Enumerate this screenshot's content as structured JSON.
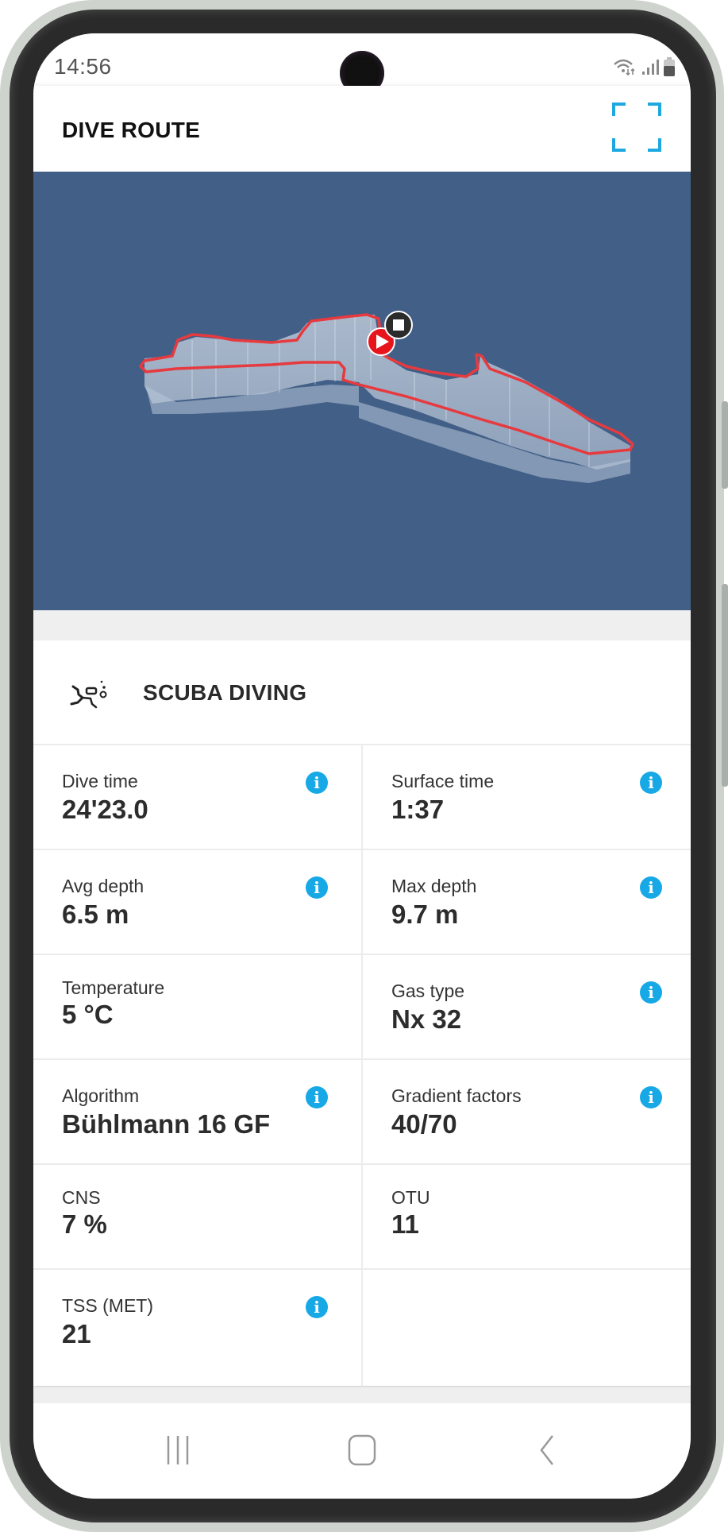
{
  "status_bar": {
    "time": "14:56",
    "icons": [
      "wifi-icon",
      "signal-icon",
      "battery-icon"
    ]
  },
  "app_bar": {
    "title": "DIVE ROUTE",
    "fullscreen_icon": "fullscreen-icon"
  },
  "map": {
    "background_color": "#425f87",
    "route_color": "#e63a3f",
    "start_marker": "play-icon",
    "end_marker": "stop-icon"
  },
  "activity": {
    "icon": "scuba-diver-icon",
    "title": "SCUBA DIVING"
  },
  "stats": [
    [
      {
        "label": "Dive time",
        "value": "24'23.0",
        "info": true
      },
      {
        "label": "Surface time",
        "value": "1:37",
        "info": true
      }
    ],
    [
      {
        "label": "Avg depth",
        "value": "6.5 m",
        "info": true
      },
      {
        "label": "Max depth",
        "value": "9.7 m",
        "info": true
      }
    ],
    [
      {
        "label": "Temperature",
        "value": "5 °C",
        "info": false
      },
      {
        "label": "Gas type",
        "value": "Nx 32",
        "info": true
      }
    ],
    [
      {
        "label": "Algorithm",
        "value": "Bühlmann 16 GF",
        "info": true
      },
      {
        "label": "Gradient factors",
        "value": "40/70",
        "info": true
      }
    ],
    [
      {
        "label": "CNS",
        "value": "7 %",
        "info": false
      },
      {
        "label": "OTU",
        "value": "11",
        "info": false
      }
    ],
    [
      {
        "label": "TSS (MET)",
        "value": "21",
        "info": true
      }
    ]
  ],
  "info_glyph": "i",
  "accent_color": "#17a8e6",
  "nav_bar": [
    "recent-apps-icon",
    "home-icon",
    "back-icon"
  ]
}
